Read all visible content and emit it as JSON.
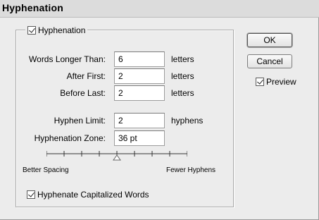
{
  "dialog": {
    "title": "Hyphenation",
    "group_checkbox": {
      "label": "Hyphenation",
      "checked": true
    }
  },
  "fields": {
    "words_longer": {
      "label": "Words Longer Than:",
      "value": "6",
      "unit": "letters"
    },
    "after_first": {
      "label": "After First:",
      "value": "2",
      "unit": "letters"
    },
    "before_last": {
      "label": "Before Last:",
      "value": "2",
      "unit": "letters"
    },
    "hyphen_limit": {
      "label": "Hyphen Limit:",
      "value": "2",
      "unit": "hyphens"
    },
    "zone": {
      "label": "Hyphenation Zone:",
      "value": "36 pt"
    }
  },
  "slider": {
    "left_label": "Better Spacing",
    "right_label": "Fewer Hyphens",
    "ticks": 9,
    "value": 0.5
  },
  "capitalized": {
    "label": "Hyphenate Capitalized Words",
    "checked": true
  },
  "buttons": {
    "ok": "OK",
    "cancel": "Cancel"
  },
  "preview": {
    "label": "Preview",
    "checked": true
  }
}
